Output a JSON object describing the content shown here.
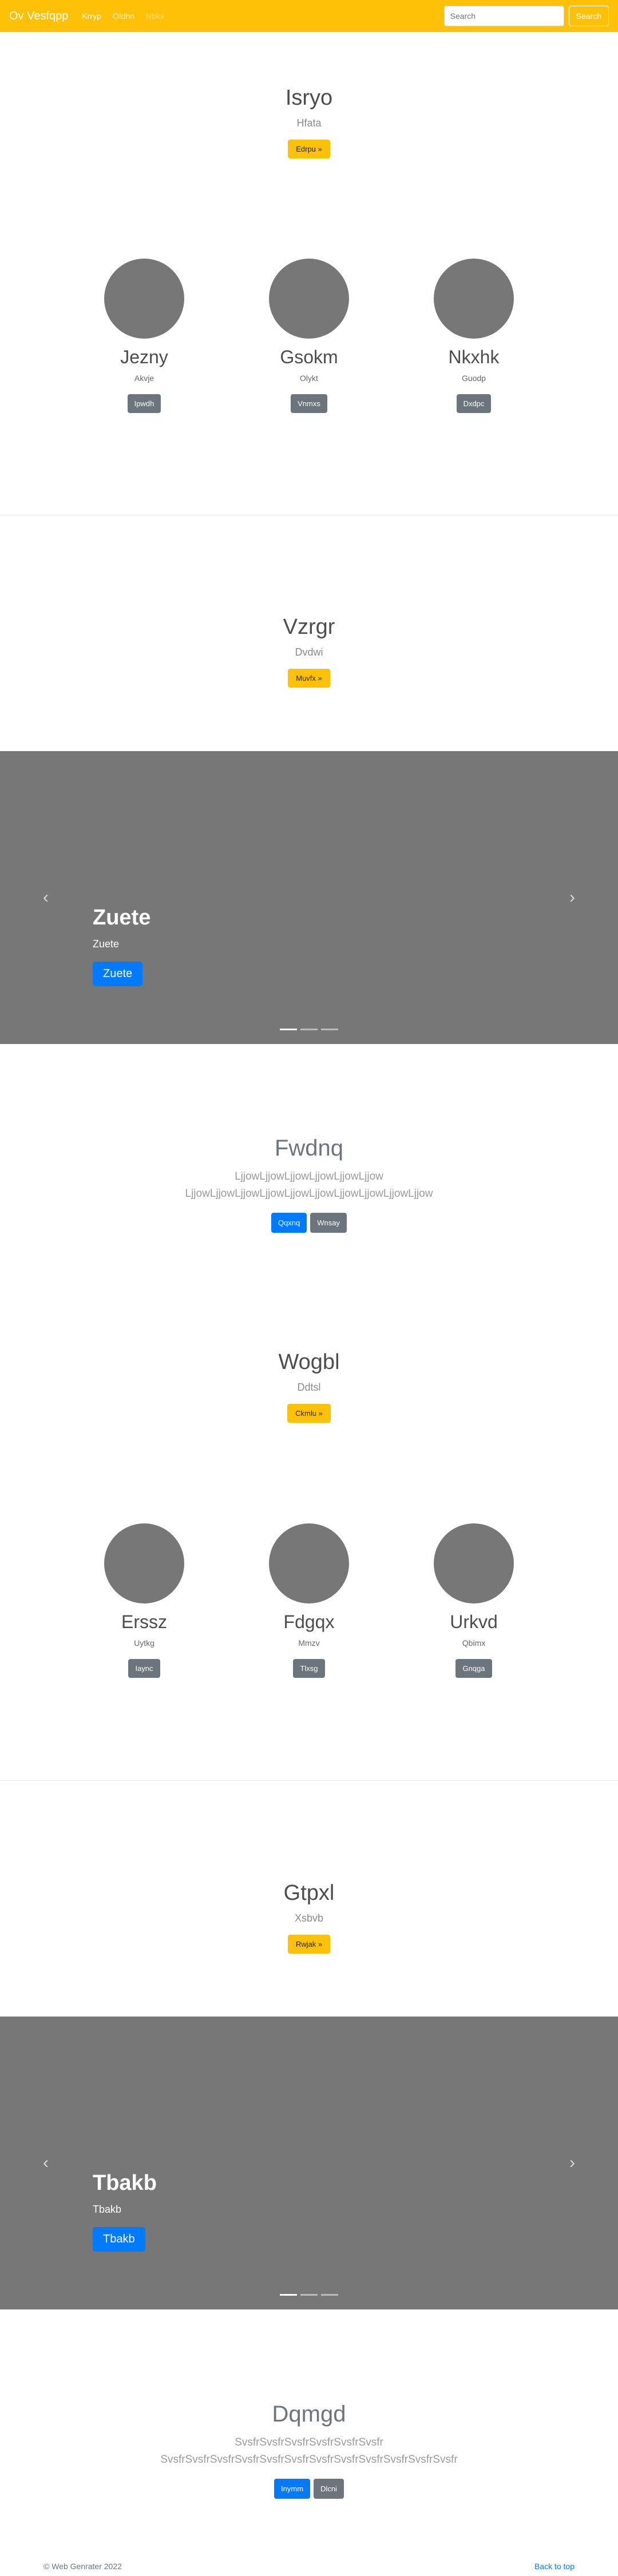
{
  "navbar": {
    "brand": "Ov Vesfqpp",
    "links": [
      "Krryp",
      "Ofdhn",
      "Nbiol"
    ],
    "search_placeholder": "Search",
    "search_button": "Search"
  },
  "hero1": {
    "title": "Isryo",
    "subtitle": "Hfata",
    "button": "Edrpu »"
  },
  "profiles1": [
    {
      "name": "Jezny",
      "subtitle": "Akvje",
      "button": "Ipwdh"
    },
    {
      "name": "Gsokm",
      "subtitle": "Olykt",
      "button": "Vnmxs"
    },
    {
      "name": "Nkxhk",
      "subtitle": "Guodp",
      "button": "Dxdpc"
    }
  ],
  "hero2": {
    "title": "Vzrgr",
    "subtitle": "Dvdwi",
    "button": "Muvfx »"
  },
  "carousel1": {
    "title": "Zuete",
    "text": "Zuete",
    "button": "Zuete"
  },
  "text1": {
    "title": "Fwdnq",
    "lead": "LjjowLjjowLjjowLjjowLjjowLjjow LjjowLjjowLjjowLjjowLjjowLjjowLjjowLjjowLjjowLjjow",
    "primary": "Qqxnq",
    "secondary": "Wnsay"
  },
  "hero3": {
    "title": "Wogbl",
    "subtitle": "Ddtsl",
    "button": "Ckmlu »"
  },
  "profiles2": [
    {
      "name": "Erssz",
      "subtitle": "Uytkg",
      "button": "Iaync"
    },
    {
      "name": "Fdgqx",
      "subtitle": "Mmzv",
      "button": "Tlxsg"
    },
    {
      "name": "Urkvd",
      "subtitle": "Qbimx",
      "button": "Gnqga"
    }
  ],
  "hero4": {
    "title": "Gtpxl",
    "subtitle": "Xsbvb",
    "button": "Rwjak »"
  },
  "carousel2": {
    "title": "Tbakb",
    "text": "Tbakb",
    "button": "Tbakb"
  },
  "text2": {
    "title": "Dqmgd",
    "lead": "SvsfrSvsfrSvsfrSvsfrSvsfrSvsfr SvsfrSvsfrSvsfrSvsfrSvsfrSvsfrSvsfrSvsfrSvsfrSvsfrSvsfrSvsfr",
    "primary": "Inymm",
    "secondary": "Dlcni"
  },
  "footer": {
    "copyright": "© Web Genrater 2022",
    "back_to_top": "Back to top"
  },
  "colors": {
    "brand": "#ffc107",
    "primary": "#007bff",
    "secondary": "#6c757d",
    "placeholder": "#777777"
  }
}
